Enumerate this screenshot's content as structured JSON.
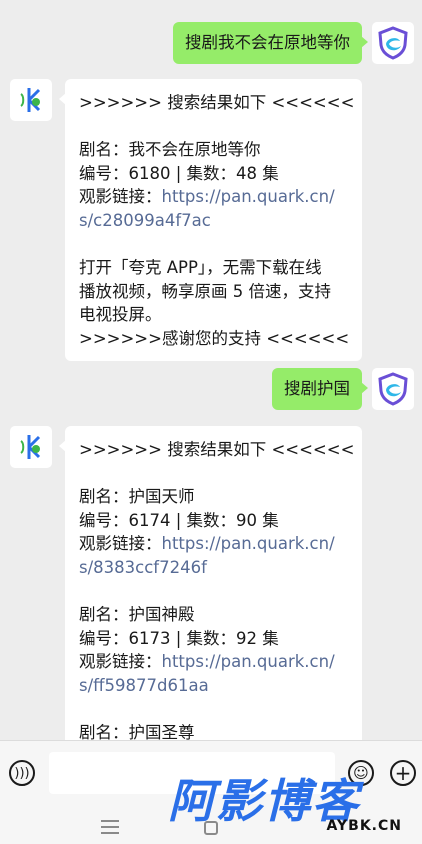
{
  "messages": [
    {
      "type": "out",
      "text": "搜剧我不会在原地等你"
    },
    {
      "type": "in",
      "lines": [
        {
          "text": ">>>>>> 搜索结果如下 <<<<<<"
        },
        {
          "gap": true
        },
        {
          "text": "剧名：我不会在原地等你"
        },
        {
          "text": "编号：6180 | 集数：48 集"
        },
        {
          "prefix": "观影链接：",
          "link": "https://pan.quark.cn/"
        },
        {
          "link": "s/c28099a4f7ac"
        },
        {
          "gap": true
        },
        {
          "text": "打开「夸克 APP」，无需下载在线"
        },
        {
          "text": "播放视频，畅享原画 5 倍速，支持"
        },
        {
          "text": "电视投屏。"
        },
        {
          "text": ">>>>>>感谢您的支持 <<<<<<"
        }
      ]
    },
    {
      "type": "out",
      "text": "搜剧护国"
    },
    {
      "type": "in",
      "lines": [
        {
          "text": ">>>>>> 搜索结果如下 <<<<<<"
        },
        {
          "gap": true
        },
        {
          "text": "剧名：护国天师"
        },
        {
          "text": "编号：6174 | 集数：90 集"
        },
        {
          "prefix": "观影链接：",
          "link": "https://pan.quark.cn/"
        },
        {
          "link": "s/8383ccf7246f"
        },
        {
          "gap": true
        },
        {
          "text": "剧名：护国神殿"
        },
        {
          "text": "编号：6173 | 集数：92 集"
        },
        {
          "prefix": "观影链接：",
          "link": "https://pan.quark.cn/"
        },
        {
          "link": "s/ff59877d61aa"
        },
        {
          "gap": true
        },
        {
          "text": "剧名：护国圣尊"
        }
      ]
    }
  ],
  "watermark": {
    "cn": "阿影博客",
    "en": "AYBK.CN"
  },
  "icons": {
    "user_avatar": "shield-logo-icon",
    "bot_avatar": "bot-logo-icon",
    "voice": "voice-icon",
    "emoji": "emoji-icon",
    "plus": "plus-icon"
  },
  "colors": {
    "out_bubble": "#95ec69",
    "link": "#576b95",
    "background": "#ededed"
  }
}
